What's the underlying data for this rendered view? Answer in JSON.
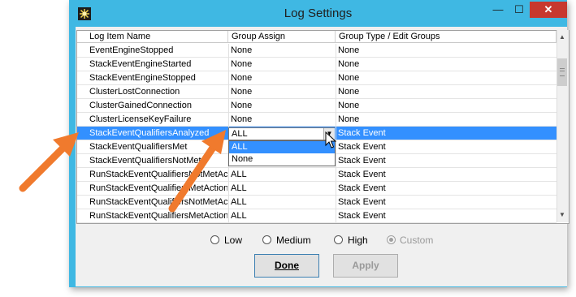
{
  "window": {
    "title": "Log Settings",
    "min_glyph": "—",
    "max_glyph": "☐",
    "close_glyph": "✕"
  },
  "grid": {
    "headers": [
      "Log Item Name",
      "Group Assign",
      "Group Type / Edit Groups"
    ],
    "rows": [
      {
        "name": "EventEngineStopped",
        "group": "None",
        "type": "None"
      },
      {
        "name": "StackEventEngineStarted",
        "group": "None",
        "type": "None"
      },
      {
        "name": "StackEventEngineStopped",
        "group": "None",
        "type": "None"
      },
      {
        "name": "ClusterLostConnection",
        "group": "None",
        "type": "None"
      },
      {
        "name": "ClusterGainedConnection",
        "group": "None",
        "type": "None"
      },
      {
        "name": "ClusterLicenseKeyFailure",
        "group": "None",
        "type": "None"
      },
      {
        "name": "StackEventQualifiersAnalyzed",
        "group": "ALL",
        "type": "Stack Event"
      },
      {
        "name": "StackEventQualifiersMet",
        "group": "",
        "type": "Stack Event"
      },
      {
        "name": "StackEventQualifiersNotMet",
        "group": "",
        "type": "Stack Event"
      },
      {
        "name": "RunStackEventQualifiersNotMetAction",
        "group": "ALL",
        "type": "Stack Event"
      },
      {
        "name": "RunStackEventQualifiersMetAction",
        "group": "ALL",
        "type": "Stack Event"
      },
      {
        "name": "RunStackEventQualifiersNotMetAction",
        "group": "ALL",
        "type": "Stack Event"
      },
      {
        "name": "RunStackEventQualifiersMetAction",
        "group": "ALL",
        "type": "Stack Event"
      }
    ],
    "selected_row": 6,
    "dropdown": {
      "value": "ALL",
      "options": [
        "ALL",
        "None"
      ],
      "highlighted": "ALL"
    }
  },
  "levels": {
    "options": [
      "Low",
      "Medium",
      "High",
      "Custom"
    ],
    "selected": "Custom"
  },
  "buttons": {
    "done": "Done",
    "apply": "Apply"
  },
  "colors": {
    "titlebar": "#3fb8e3",
    "selection": "#3390ff",
    "close": "#c7382e",
    "arrow": "#f07a2d"
  }
}
